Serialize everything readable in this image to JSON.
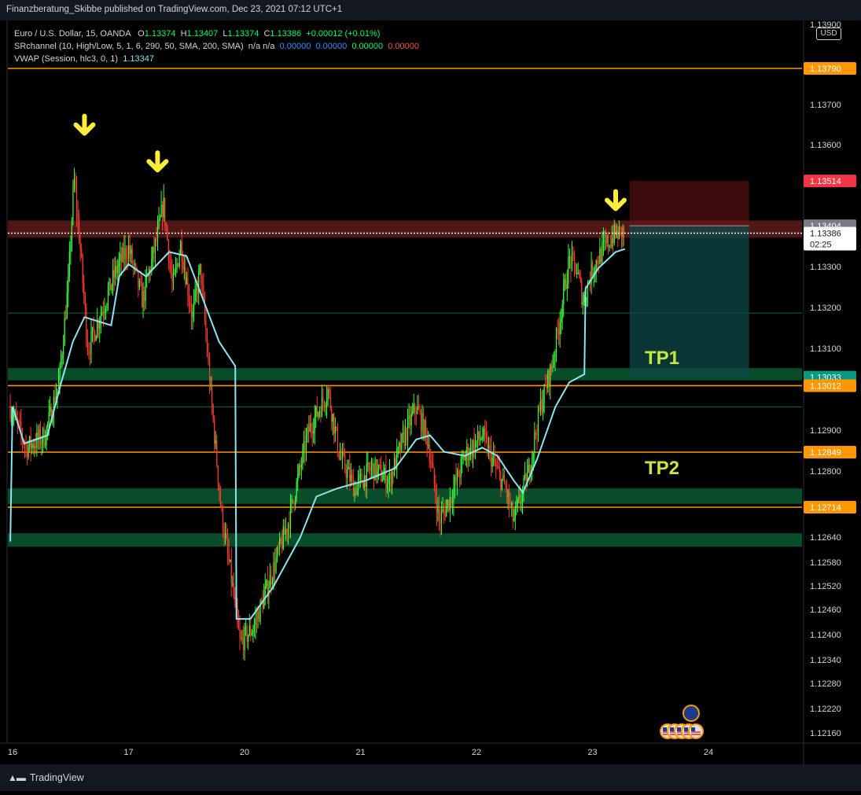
{
  "publisher": "Finanzberatung_Skibbe published on TradingView.com, Dec 23, 2021 07:12 UTC+1",
  "legend": {
    "symbol": "Euro / U.S. Dollar, 15, OANDA",
    "o_label": "O",
    "o": "1.13374",
    "h_label": "H",
    "h": "1.13407",
    "l_label": "L",
    "l": "1.13374",
    "c_label": "C",
    "c": "1.13386",
    "chg": "+0.00012 (+0.01%)",
    "sr_name": "SRchannel (10, High/Low, 5, 1, 6, 290, 50, SMA, 200, SMA)",
    "sr_na": "n/a n/a",
    "sr_v1": "0.00000",
    "sr_v2": "0.00000",
    "sr_v3": "0.00000",
    "sr_v4": "0.00000",
    "vwap_name": "VWAP (Session, hlc3, 0, 1)",
    "vwap_val": "1.13347"
  },
  "currency": "USD",
  "brand": "TradingView",
  "chart_data": {
    "type": "candlestick",
    "symbol": "EUR/USD",
    "timeframe": "15",
    "ylim": [
      1.1212,
      1.1392
    ],
    "y_ticks": [
      "1.13900",
      "1.13700",
      "1.13600",
      "1.13300",
      "1.13200",
      "1.13100",
      "1.12900",
      "1.12800",
      "1.12640",
      "1.12580",
      "1.12520",
      "1.12460",
      "1.12400",
      "1.12340",
      "1.12280",
      "1.12220",
      "1.12160"
    ],
    "x_ticks": [
      {
        "label": "16",
        "day": 0
      },
      {
        "label": "17",
        "day": 1
      },
      {
        "label": "20",
        "day": 2
      },
      {
        "label": "21",
        "day": 3
      },
      {
        "label": "22",
        "day": 4
      },
      {
        "label": "23",
        "day": 5
      },
      {
        "label": "24",
        "day": 6
      }
    ],
    "price_path": [
      {
        "day": -0.02,
        "price": 1.1296
      },
      {
        "day": 0.12,
        "price": 1.1286
      },
      {
        "day": 0.28,
        "price": 1.1289
      },
      {
        "day": 0.4,
        "price": 1.1302
      },
      {
        "day": 0.48,
        "price": 1.1326
      },
      {
        "day": 0.53,
        "price": 1.1352
      },
      {
        "day": 0.58,
        "price": 1.1336
      },
      {
        "day": 0.65,
        "price": 1.131
      },
      {
        "day": 0.75,
        "price": 1.1318
      },
      {
        "day": 0.9,
        "price": 1.133
      },
      {
        "day": 1.0,
        "price": 1.1335
      },
      {
        "day": 1.12,
        "price": 1.1322
      },
      {
        "day": 1.25,
        "price": 1.1338
      },
      {
        "day": 1.3,
        "price": 1.1346
      },
      {
        "day": 1.38,
        "price": 1.1325
      },
      {
        "day": 1.45,
        "price": 1.1336
      },
      {
        "day": 1.55,
        "price": 1.1318
      },
      {
        "day": 1.62,
        "price": 1.133
      },
      {
        "day": 1.7,
        "price": 1.1302
      },
      {
        "day": 1.8,
        "price": 1.127
      },
      {
        "day": 1.88,
        "price": 1.1255
      },
      {
        "day": 1.96,
        "price": 1.1238
      },
      {
        "day": 2.08,
        "price": 1.1242
      },
      {
        "day": 2.2,
        "price": 1.1252
      },
      {
        "day": 2.38,
        "price": 1.1268
      },
      {
        "day": 2.55,
        "price": 1.129
      },
      {
        "day": 2.72,
        "price": 1.13
      },
      {
        "day": 2.82,
        "price": 1.1284
      },
      {
        "day": 2.95,
        "price": 1.1276
      },
      {
        "day": 3.1,
        "price": 1.1281
      },
      {
        "day": 3.25,
        "price": 1.1278
      },
      {
        "day": 3.38,
        "price": 1.1289
      },
      {
        "day": 3.48,
        "price": 1.1296
      },
      {
        "day": 3.58,
        "price": 1.1288
      },
      {
        "day": 3.68,
        "price": 1.1268
      },
      {
        "day": 3.78,
        "price": 1.1274
      },
      {
        "day": 3.9,
        "price": 1.1284
      },
      {
        "day": 4.05,
        "price": 1.1289
      },
      {
        "day": 4.15,
        "price": 1.1282
      },
      {
        "day": 4.25,
        "price": 1.1276
      },
      {
        "day": 4.32,
        "price": 1.1268
      },
      {
        "day": 4.45,
        "price": 1.128
      },
      {
        "day": 4.55,
        "price": 1.1296
      },
      {
        "day": 4.65,
        "price": 1.1306
      },
      {
        "day": 4.72,
        "price": 1.1318
      },
      {
        "day": 4.8,
        "price": 1.1332
      },
      {
        "day": 4.86,
        "price": 1.133
      },
      {
        "day": 4.92,
        "price": 1.1322
      },
      {
        "day": 5.0,
        "price": 1.133
      },
      {
        "day": 5.08,
        "price": 1.1334
      },
      {
        "day": 5.18,
        "price": 1.1338
      },
      {
        "day": 5.28,
        "price": 1.1339
      }
    ],
    "vwap_path": [
      {
        "day": -0.02,
        "price": 1.1263
      },
      {
        "day": 0.0,
        "price": 1.1296
      },
      {
        "day": 0.1,
        "price": 1.1287
      },
      {
        "day": 0.3,
        "price": 1.1289
      },
      {
        "day": 0.42,
        "price": 1.1302
      },
      {
        "day": 0.52,
        "price": 1.1312
      },
      {
        "day": 0.62,
        "price": 1.1318
      },
      {
        "day": 0.85,
        "price": 1.1316
      },
      {
        "day": 0.92,
        "price": 1.1328
      },
      {
        "day": 1.0,
        "price": 1.1331
      },
      {
        "day": 1.15,
        "price": 1.1328
      },
      {
        "day": 1.35,
        "price": 1.1334
      },
      {
        "day": 1.5,
        "price": 1.1333
      },
      {
        "day": 1.62,
        "price": 1.1324
      },
      {
        "day": 1.78,
        "price": 1.1312
      },
      {
        "day": 1.92,
        "price": 1.1306
      },
      {
        "day": 1.93,
        "price": 1.1244
      },
      {
        "day": 2.05,
        "price": 1.1244
      },
      {
        "day": 2.25,
        "price": 1.1252
      },
      {
        "day": 2.48,
        "price": 1.1264
      },
      {
        "day": 2.62,
        "price": 1.1274
      },
      {
        "day": 2.8,
        "price": 1.1276
      },
      {
        "day": 3.05,
        "price": 1.1278
      },
      {
        "day": 3.3,
        "price": 1.1281
      },
      {
        "day": 3.48,
        "price": 1.1288
      },
      {
        "day": 3.6,
        "price": 1.1289
      },
      {
        "day": 3.72,
        "price": 1.1285
      },
      {
        "day": 3.9,
        "price": 1.1284
      },
      {
        "day": 4.05,
        "price": 1.1286
      },
      {
        "day": 4.18,
        "price": 1.1284
      },
      {
        "day": 4.32,
        "price": 1.1278
      },
      {
        "day": 4.4,
        "price": 1.1275
      },
      {
        "day": 4.52,
        "price": 1.1283
      },
      {
        "day": 4.68,
        "price": 1.1296
      },
      {
        "day": 4.8,
        "price": 1.1302
      },
      {
        "day": 4.93,
        "price": 1.1304
      },
      {
        "day": 4.94,
        "price": 1.1325
      },
      {
        "day": 5.05,
        "price": 1.133
      },
      {
        "day": 5.2,
        "price": 1.1334
      },
      {
        "day": 5.28,
        "price": 1.13347
      }
    ],
    "last_price": "1.13386",
    "countdown": "02:25",
    "price_labels": [
      {
        "price": 1.1379,
        "text": "1.13790",
        "color": "#ff9800"
      },
      {
        "price": 1.13514,
        "text": "1.13514",
        "color": "#f23645"
      },
      {
        "price": 1.13404,
        "text": "1.13404",
        "color": "#787b86"
      },
      {
        "price": 1.13033,
        "text": "1.13033",
        "color": "#089981"
      },
      {
        "price": 1.13012,
        "text": "1.13012",
        "color": "#ff9800"
      },
      {
        "price": 1.12849,
        "text": "1.12849",
        "color": "#ff9800"
      },
      {
        "price": 1.12714,
        "text": "1.12714",
        "color": "#ff9800"
      }
    ],
    "horizontal_lines": [
      {
        "price": 1.1379,
        "color": "#ff9800"
      },
      {
        "price": 1.13012,
        "color": "#ff9800"
      },
      {
        "price": 1.12849,
        "color": "#ff9800"
      },
      {
        "price": 1.12714,
        "color": "#ff9800"
      },
      {
        "price": 1.1319,
        "color": "#0e6b3a"
      },
      {
        "price": 1.1296,
        "color": "#0e6b3a"
      }
    ],
    "zones": [
      {
        "top": 1.13417,
        "bottom": 1.13375,
        "color": "#6b1f1f",
        "opacity": 0.75
      },
      {
        "top": 1.13055,
        "bottom": 1.13025,
        "color": "#0f8b4a",
        "opacity": 0.55
      },
      {
        "top": 1.1276,
        "bottom": 1.12722,
        "color": "#0f8b4a",
        "opacity": 0.55
      },
      {
        "top": 1.1265,
        "bottom": 1.12617,
        "color": "#0f8b4a",
        "opacity": 0.55
      }
    ],
    "position": {
      "entry": 1.13404,
      "stop": 1.13514,
      "target": 1.13033,
      "start_day": 5.32,
      "end_day": 6.35
    },
    "arrows": [
      {
        "day": 0.62,
        "price": 1.1365
      },
      {
        "day": 1.25,
        "price": 1.1356
      },
      {
        "day": 5.2,
        "price": 1.13465
      }
    ],
    "annotations": [
      {
        "text": "TP1",
        "day": 5.6,
        "price": 1.1308
      },
      {
        "text": "TP2",
        "day": 5.6,
        "price": 1.1281
      }
    ]
  }
}
